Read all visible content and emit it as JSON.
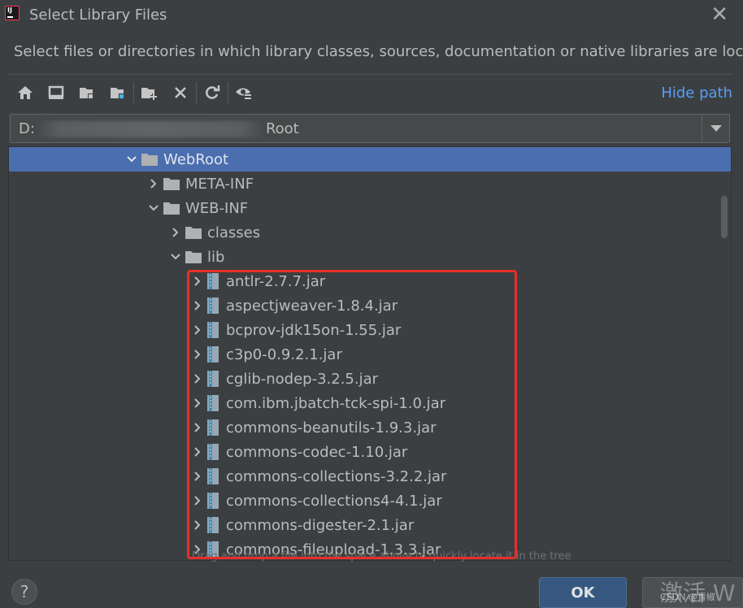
{
  "window": {
    "title": "Select Library Files",
    "description": "Select files or directories in which library classes, sources, documentation or native libraries are located"
  },
  "toolbar": {
    "buttons": [
      "home-icon",
      "desktop-icon",
      "project-folder-icon",
      "module-folder-icon",
      "new-folder-icon",
      "delete-icon",
      "refresh-icon",
      "show-hidden-icon"
    ],
    "hide_path_label": "Hide path"
  },
  "path_field": {
    "prefix": "D:",
    "suffix": "Root"
  },
  "tree": {
    "nodes": [
      {
        "label": "WebRoot",
        "type": "folder",
        "depth": 0,
        "expanded": true,
        "selected": true
      },
      {
        "label": "META-INF",
        "type": "folder",
        "depth": 1,
        "expanded": false
      },
      {
        "label": "WEB-INF",
        "type": "folder",
        "depth": 1,
        "expanded": true
      },
      {
        "label": "classes",
        "type": "folder",
        "depth": 2,
        "expanded": false
      },
      {
        "label": "lib",
        "type": "folder",
        "depth": 2,
        "expanded": true
      },
      {
        "label": "antlr-2.7.7.jar",
        "type": "jar",
        "depth": 3,
        "expanded": false
      },
      {
        "label": "aspectjweaver-1.8.4.jar",
        "type": "jar",
        "depth": 3,
        "expanded": false
      },
      {
        "label": "bcprov-jdk15on-1.55.jar",
        "type": "jar",
        "depth": 3,
        "expanded": false
      },
      {
        "label": "c3p0-0.9.2.1.jar",
        "type": "jar",
        "depth": 3,
        "expanded": false
      },
      {
        "label": "cglib-nodep-3.2.5.jar",
        "type": "jar",
        "depth": 3,
        "expanded": false
      },
      {
        "label": "com.ibm.jbatch-tck-spi-1.0.jar",
        "type": "jar",
        "depth": 3,
        "expanded": false
      },
      {
        "label": "commons-beanutils-1.9.3.jar",
        "type": "jar",
        "depth": 3,
        "expanded": false
      },
      {
        "label": "commons-codec-1.10.jar",
        "type": "jar",
        "depth": 3,
        "expanded": false
      },
      {
        "label": "commons-collections-3.2.2.jar",
        "type": "jar",
        "depth": 3,
        "expanded": false
      },
      {
        "label": "commons-collections4-4.1.jar",
        "type": "jar",
        "depth": 3,
        "expanded": false
      },
      {
        "label": "commons-digester-2.1.jar",
        "type": "jar",
        "depth": 3,
        "expanded": false
      },
      {
        "label": "commons-fileupload-1.3.3.jar",
        "type": "jar",
        "depth": 3,
        "expanded": false
      }
    ],
    "hint": "Drag and drop a file into the space above to quickly locate it in the tree"
  },
  "footer": {
    "help_label": "?",
    "ok_label": "OK",
    "watermark": "激活 W",
    "watermark_small": "CSDN @青椒"
  },
  "colors": {
    "background": "#3c3f41",
    "selection": "#4b6eaf",
    "link": "#589df6",
    "highlight_box": "#e7302a",
    "ok_button": "#365880"
  }
}
